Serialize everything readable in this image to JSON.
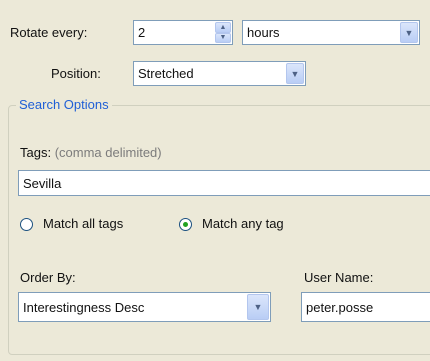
{
  "rotate": {
    "label": "Rotate every:",
    "value": "2",
    "unit": "hours"
  },
  "position": {
    "label": "Position:",
    "value": "Stretched"
  },
  "search_options": {
    "title": "Search Options",
    "tags": {
      "label": "Tags:",
      "hint": "(comma delimited)",
      "value": "Sevilla"
    },
    "match_all": {
      "label": "Match all tags",
      "selected": false
    },
    "match_any": {
      "label": "Match any tag",
      "selected": true
    },
    "order_by": {
      "label": "Order By:",
      "value": "Interestingness Desc"
    },
    "user_name": {
      "label": "User Name:",
      "value": "peter.posse"
    }
  },
  "colors": {
    "background": "#ece9d8",
    "field_border": "#7f9db9",
    "group_title": "#1f5fd6",
    "radio_selected": "#21a121"
  },
  "icons": {
    "dropdown": "chevron-down-icon",
    "spin_up": "spin-up-icon",
    "spin_down": "spin-down-icon"
  }
}
